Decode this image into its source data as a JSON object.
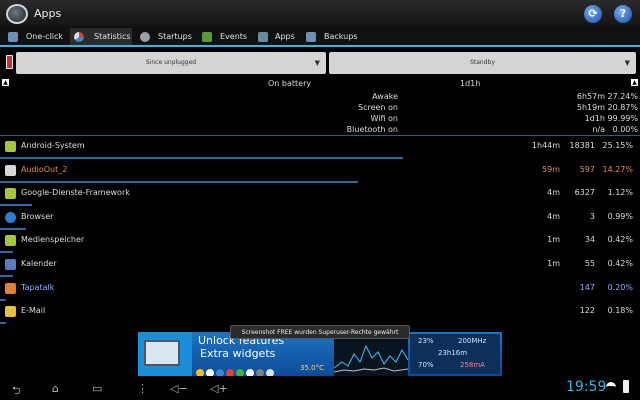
{
  "app": {
    "title": "Apps"
  },
  "tabs": [
    {
      "label": "One-click",
      "icon": "lightning-icon",
      "color": "#6b8fb8"
    },
    {
      "label": "Statistics",
      "icon": "pie-icon",
      "color": "#d04040"
    },
    {
      "label": "Startups",
      "icon": "gear-icon",
      "color": "#9aa2aa"
    },
    {
      "label": "Events",
      "icon": "android-icon",
      "color": "#5a9a3a"
    },
    {
      "label": "Apps",
      "icon": "android-icon",
      "color": "#6a8aa0"
    },
    {
      "label": "Backups",
      "icon": "backup-icon",
      "color": "#7090b0"
    }
  ],
  "spinners": {
    "left": "Since unplugged",
    "right": "Standby"
  },
  "summary": {
    "status": "On battery",
    "duration": "1d1h",
    "lines": [
      {
        "label": "Awake",
        "time": "6h57m",
        "pct": "27.24%"
      },
      {
        "label": "Screen on",
        "time": "5h19m",
        "pct": "20.87%"
      },
      {
        "label": "Wifi on",
        "time": "1d1h",
        "pct": "99.99%"
      },
      {
        "label": "Bluetooth on",
        "time": "n/a",
        "pct": "0.00%"
      }
    ]
  },
  "rows": [
    {
      "name": "Android-System",
      "time": "1h44m",
      "count": "18381",
      "pct": "25.15%",
      "icon": "android-icon",
      "color": "#dcdcdc",
      "pct_color": "#dcdcdc",
      "bar": 0.63
    },
    {
      "name": "AudioOut_2",
      "time": "59m",
      "count": "597",
      "pct": "14.27%",
      "icon": "audio-icon",
      "color": "#e0904a",
      "pct_color": "#e0904a",
      "bar": 0.56
    },
    {
      "name": "Google-Dienste-Framework",
      "time": "4m",
      "count": "6327",
      "pct": "1.12%",
      "icon": "android-icon",
      "color": "#dcdcdc",
      "pct_color": "#dcdcdc",
      "bar": 0.05
    },
    {
      "name": "Browser",
      "time": "4m",
      "count": "3",
      "pct": "0.99%",
      "icon": "globe-icon",
      "color": "#dcdcdc",
      "pct_color": "#dcdcdc",
      "bar": 0.04
    },
    {
      "name": "Medienspeicher",
      "time": "1m",
      "count": "34",
      "pct": "0.42%",
      "icon": "android-icon",
      "color": "#dcdcdc",
      "pct_color": "#dcdcdc",
      "bar": 0.02
    },
    {
      "name": "Kalender",
      "time": "1m",
      "count": "55",
      "pct": "0.42%",
      "icon": "calendar-icon",
      "color": "#dcdcdc",
      "pct_color": "#dcdcdc",
      "bar": 0.02
    },
    {
      "name": "Tapatalk",
      "time": "",
      "count": "147",
      "pct": "0.20%",
      "icon": "tapatalk-icon",
      "color": "#8ab0ff",
      "pct_color": "#8ab0ff",
      "bar": 0.01
    },
    {
      "name": "E-Mail",
      "time": "",
      "count": "122",
      "pct": "0.18%",
      "icon": "mail-icon",
      "color": "#dcdcdc",
      "pct_color": "#dcdcdc",
      "bar": 0.01
    }
  ],
  "ad": {
    "line1": "Unlock features",
    "line2": "Extra widgets",
    "temp": "35.0°C",
    "cpu_pct": "23%",
    "freq": "200MHz",
    "uptime": "23h16m",
    "mem_pct": "70%",
    "current": "258mA"
  },
  "toast": "Screenshot FREE wurden Superuser-Rechte gewährt",
  "status": {
    "clock": "19:59"
  },
  "nav": {
    "back": "back-icon",
    "home": "home-icon",
    "recents": "recents-icon",
    "menu": "menu-icon",
    "vol_down": "volume-down-icon",
    "vol_up": "volume-up-icon"
  },
  "accent": "#33b5e5"
}
